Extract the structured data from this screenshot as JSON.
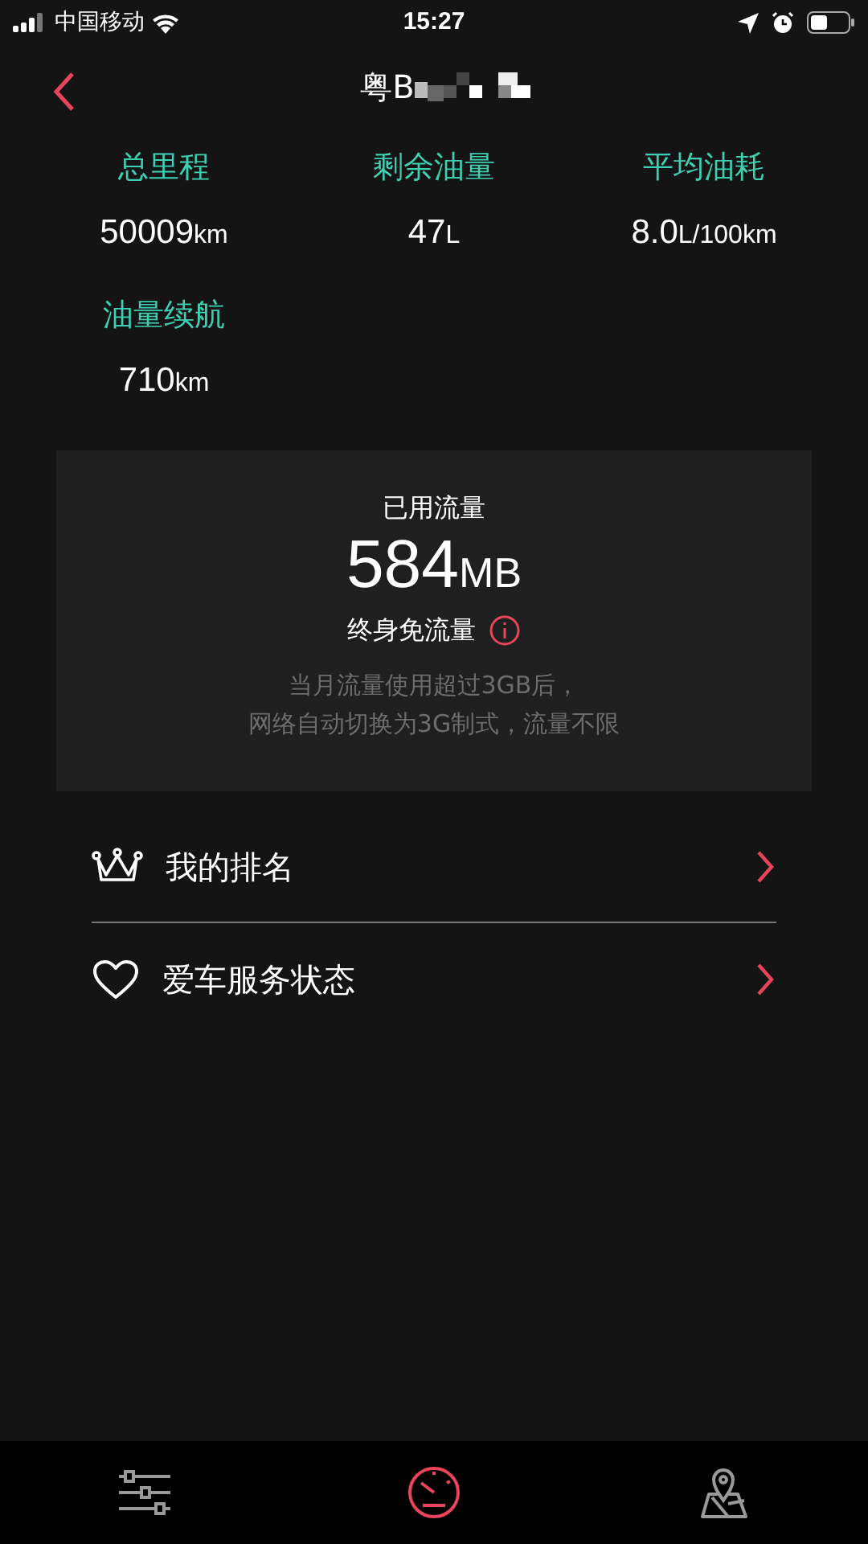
{
  "status_bar": {
    "carrier": "中国移动",
    "time": "15:27"
  },
  "header": {
    "title": "粤B"
  },
  "stats": [
    {
      "label": "总里程",
      "value": "50009",
      "unit": "km"
    },
    {
      "label": "剩余油量",
      "value": "47",
      "unit": "L"
    },
    {
      "label": "平均油耗",
      "value": "8.0",
      "unit": "L/100km"
    },
    {
      "label": "油量续航",
      "value": "710",
      "unit": "km"
    }
  ],
  "data_card": {
    "title": "已用流量",
    "value": "584",
    "unit": "MB",
    "plan": "终身免流量",
    "note_lines": [
      "当月流量使用超过3GB后，",
      "网络自动切换为3G制式，流量不限"
    ]
  },
  "menu": [
    {
      "kind": "crown",
      "label": "我的排名"
    },
    {
      "kind": "heart",
      "label": "爱车服务状态"
    }
  ],
  "tab_bar": [
    {
      "kind": "settings",
      "selected": false
    },
    {
      "kind": "gauge",
      "selected": true
    },
    {
      "kind": "map",
      "selected": false
    }
  ]
}
